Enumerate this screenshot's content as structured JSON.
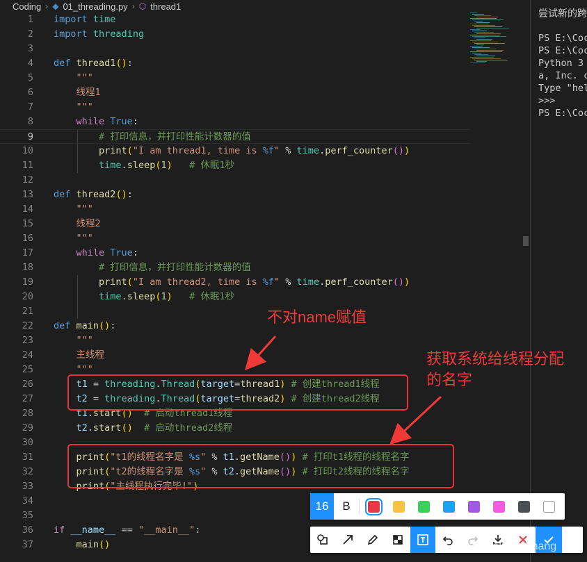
{
  "breadcrumb": {
    "folder": "Coding",
    "file": "01_threading.py",
    "symbol": "thread1"
  },
  "code_lines": [
    {
      "n": "1",
      "t": [
        [
          "kw",
          "import"
        ],
        [
          "op",
          " "
        ],
        [
          "mod",
          "time"
        ]
      ]
    },
    {
      "n": "2",
      "t": [
        [
          "kw",
          "import"
        ],
        [
          "op",
          " "
        ],
        [
          "mod",
          "threading"
        ]
      ]
    },
    {
      "n": "3",
      "t": []
    },
    {
      "n": "4",
      "t": [
        [
          "kw",
          "def"
        ],
        [
          "op",
          " "
        ],
        [
          "fn",
          "thread1"
        ],
        [
          "pB",
          "()"
        ],
        [
          "op",
          ":"
        ]
      ]
    },
    {
      "n": "5",
      "t": [
        [
          "str",
          "    \"\"\""
        ]
      ]
    },
    {
      "n": "6",
      "t": [
        [
          "str",
          "    线程1"
        ]
      ]
    },
    {
      "n": "7",
      "t": [
        [
          "str",
          "    \"\"\""
        ]
      ]
    },
    {
      "n": "8",
      "t": [
        [
          "op",
          "    "
        ],
        [
          "ctl",
          "while"
        ],
        [
          "op",
          " "
        ],
        [
          "kw",
          "True"
        ],
        [
          "op",
          ":"
        ]
      ]
    },
    {
      "n": "9",
      "t": [
        [
          "cmt",
          "        # 打印信息，并打印性能计数器的值"
        ]
      ]
    },
    {
      "n": "10",
      "t": [
        [
          "op",
          "        "
        ],
        [
          "fn",
          "print"
        ],
        [
          "pB",
          "("
        ],
        [
          "str",
          "\"I am thread1, time is "
        ],
        [
          "fmt",
          "%f"
        ],
        [
          "str",
          "\""
        ],
        [
          "op",
          " % "
        ],
        [
          "mod",
          "time"
        ],
        [
          "op",
          "."
        ],
        [
          "fn",
          "perf_counter"
        ],
        [
          "pP",
          "()"
        ],
        [
          "pB",
          ")"
        ]
      ]
    },
    {
      "n": "11",
      "t": [
        [
          "op",
          "        "
        ],
        [
          "mod",
          "time"
        ],
        [
          "op",
          "."
        ],
        [
          "fn",
          "sleep"
        ],
        [
          "pB",
          "("
        ],
        [
          "num",
          "1"
        ],
        [
          "pB",
          ")"
        ],
        [
          "op",
          "   "
        ],
        [
          "cmt",
          "# 休眠1秒"
        ]
      ]
    },
    {
      "n": "12",
      "t": []
    },
    {
      "n": "13",
      "t": [
        [
          "kw",
          "def"
        ],
        [
          "op",
          " "
        ],
        [
          "fn",
          "thread2"
        ],
        [
          "pB",
          "()"
        ],
        [
          "op",
          ":"
        ]
      ]
    },
    {
      "n": "14",
      "t": [
        [
          "str",
          "    \"\"\""
        ]
      ]
    },
    {
      "n": "15",
      "t": [
        [
          "str",
          "    线程2"
        ]
      ]
    },
    {
      "n": "16",
      "t": [
        [
          "str",
          "    \"\"\""
        ]
      ]
    },
    {
      "n": "17",
      "t": [
        [
          "op",
          "    "
        ],
        [
          "ctl",
          "while"
        ],
        [
          "op",
          " "
        ],
        [
          "kw",
          "True"
        ],
        [
          "op",
          ":"
        ]
      ]
    },
    {
      "n": "18",
      "t": [
        [
          "cmt",
          "        # 打印信息，并打印性能计数器的值"
        ]
      ]
    },
    {
      "n": "19",
      "t": [
        [
          "op",
          "        "
        ],
        [
          "fn",
          "print"
        ],
        [
          "pB",
          "("
        ],
        [
          "str",
          "\"I am thread2, time is "
        ],
        [
          "fmt",
          "%f"
        ],
        [
          "str",
          "\""
        ],
        [
          "op",
          " % "
        ],
        [
          "mod",
          "time"
        ],
        [
          "op",
          "."
        ],
        [
          "fn",
          "perf_counter"
        ],
        [
          "pP",
          "()"
        ],
        [
          "pB",
          ")"
        ]
      ]
    },
    {
      "n": "20",
      "t": [
        [
          "op",
          "        "
        ],
        [
          "mod",
          "time"
        ],
        [
          "op",
          "."
        ],
        [
          "fn",
          "sleep"
        ],
        [
          "pB",
          "("
        ],
        [
          "num",
          "1"
        ],
        [
          "pB",
          ")"
        ],
        [
          "op",
          "   "
        ],
        [
          "cmt",
          "# 休眠1秒"
        ]
      ]
    },
    {
      "n": "21",
      "t": []
    },
    {
      "n": "22",
      "t": [
        [
          "kw",
          "def"
        ],
        [
          "op",
          " "
        ],
        [
          "fn",
          "main"
        ],
        [
          "pB",
          "()"
        ],
        [
          "op",
          ":"
        ]
      ]
    },
    {
      "n": "23",
      "t": [
        [
          "str",
          "    \"\"\""
        ]
      ]
    },
    {
      "n": "24",
      "t": [
        [
          "str",
          "    主线程"
        ]
      ]
    },
    {
      "n": "25",
      "t": [
        [
          "str",
          "    \"\"\""
        ]
      ]
    },
    {
      "n": "26",
      "t": [
        [
          "op",
          "    "
        ],
        [
          "var",
          "t1"
        ],
        [
          "op",
          " = "
        ],
        [
          "mod",
          "threading"
        ],
        [
          "op",
          "."
        ],
        [
          "mod",
          "Thread"
        ],
        [
          "pB",
          "("
        ],
        [
          "var",
          "target"
        ],
        [
          "op",
          "="
        ],
        [
          "fn",
          "thread1"
        ],
        [
          "pB",
          ")"
        ],
        [
          "op",
          " "
        ],
        [
          "cmt",
          "# 创建thread1线程"
        ]
      ]
    },
    {
      "n": "27",
      "t": [
        [
          "op",
          "    "
        ],
        [
          "var",
          "t2"
        ],
        [
          "op",
          " = "
        ],
        [
          "mod",
          "threading"
        ],
        [
          "op",
          "."
        ],
        [
          "mod",
          "Thread"
        ],
        [
          "pB",
          "("
        ],
        [
          "var",
          "target"
        ],
        [
          "op",
          "="
        ],
        [
          "fn",
          "thread2"
        ],
        [
          "pB",
          ")"
        ],
        [
          "op",
          " "
        ],
        [
          "cmt",
          "# 创建thread2线程"
        ]
      ]
    },
    {
      "n": "28",
      "t": [
        [
          "op",
          "    "
        ],
        [
          "var",
          "t1"
        ],
        [
          "op",
          "."
        ],
        [
          "fn",
          "start"
        ],
        [
          "pB",
          "()"
        ],
        [
          "op",
          "  "
        ],
        [
          "cmt",
          "# 启动thread1线程"
        ]
      ]
    },
    {
      "n": "29",
      "t": [
        [
          "op",
          "    "
        ],
        [
          "var",
          "t2"
        ],
        [
          "op",
          "."
        ],
        [
          "fn",
          "start"
        ],
        [
          "pB",
          "()"
        ],
        [
          "op",
          "  "
        ],
        [
          "cmt",
          "# 启动thread2线程"
        ]
      ]
    },
    {
      "n": "30",
      "t": []
    },
    {
      "n": "31",
      "t": [
        [
          "op",
          "    "
        ],
        [
          "fn",
          "print"
        ],
        [
          "pB",
          "("
        ],
        [
          "str",
          "\"t1的线程名字是 "
        ],
        [
          "fmt",
          "%s"
        ],
        [
          "str",
          "\""
        ],
        [
          "op",
          " % "
        ],
        [
          "var",
          "t1"
        ],
        [
          "op",
          "."
        ],
        [
          "fn",
          "getName"
        ],
        [
          "pP",
          "()"
        ],
        [
          "pB",
          ")"
        ],
        [
          "op",
          " "
        ],
        [
          "cmt",
          "# 打印t1线程的线程名字"
        ]
      ]
    },
    {
      "n": "32",
      "t": [
        [
          "op",
          "    "
        ],
        [
          "fn",
          "print"
        ],
        [
          "pB",
          "("
        ],
        [
          "str",
          "\"t2的线程名字是 "
        ],
        [
          "fmt",
          "%s"
        ],
        [
          "str",
          "\""
        ],
        [
          "op",
          " % "
        ],
        [
          "var",
          "t2"
        ],
        [
          "op",
          "."
        ],
        [
          "fn",
          "getName"
        ],
        [
          "pP",
          "()"
        ],
        [
          "pB",
          ")"
        ],
        [
          "op",
          " "
        ],
        [
          "cmt",
          "# 打印t2线程的线程名字"
        ]
      ]
    },
    {
      "n": "33",
      "t": [
        [
          "op",
          "    "
        ],
        [
          "fn",
          "print"
        ],
        [
          "pB",
          "("
        ],
        [
          "str",
          "\"主线程执行完毕!\""
        ],
        [
          "pB",
          ")"
        ]
      ]
    },
    {
      "n": "34",
      "t": []
    },
    {
      "n": "35",
      "t": []
    },
    {
      "n": "36",
      "t": [
        [
          "ctl",
          "if"
        ],
        [
          "op",
          " "
        ],
        [
          "var",
          "__name__"
        ],
        [
          "op",
          " == "
        ],
        [
          "str",
          "\"__main__\""
        ],
        [
          "op",
          ":"
        ]
      ]
    },
    {
      "n": "37",
      "t": [
        [
          "op",
          "    "
        ],
        [
          "fn",
          "main"
        ],
        [
          "pB",
          "()"
        ]
      ]
    }
  ],
  "terminal_lines": [
    "尝试新的跨",
    "",
    "PS E:\\Coc",
    "PS E:\\Coc",
    "Python 3",
    "a, Inc. c",
    "Type \"hel",
    ">>>",
    "PS E:\\Coc"
  ],
  "annotations": {
    "label1": "不对name赋值",
    "label2_line1": "获取系统给线程分配",
    "label2_line2": "的名字"
  },
  "toolbar": {
    "font_size": "16",
    "bold_label": "B",
    "colors": [
      "#e63946",
      "#f6c343",
      "#3ccf5a",
      "#1da1f2",
      "#a259e6",
      "#f25ce0",
      "#4a4f55",
      "#ffffff"
    ],
    "tools_row2": [
      "shape",
      "arrow",
      "pen",
      "mosaic",
      "text",
      "undo",
      "redo",
      "download",
      "cancel",
      "confirm"
    ]
  },
  "watermark": "CSDN @Wallace Zhang"
}
